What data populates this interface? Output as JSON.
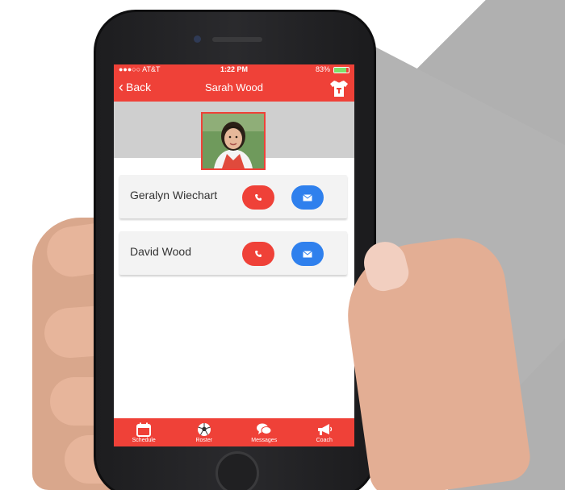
{
  "status_bar": {
    "carrier": "●●●○○ AT&T",
    "time": "1:22 PM",
    "battery": "83%"
  },
  "header": {
    "back_label": "Back",
    "title": "Sarah Wood"
  },
  "contacts": [
    {
      "name": "Geralyn Wiechart"
    },
    {
      "name": "David Wood"
    }
  ],
  "tabs": [
    {
      "label": "Schedule",
      "icon": "calendar-icon"
    },
    {
      "label": "Roster",
      "icon": "soccer-ball-icon"
    },
    {
      "label": "Messages",
      "icon": "chat-bubbles-icon"
    },
    {
      "label": "Coach",
      "icon": "megaphone-icon"
    }
  ],
  "colors": {
    "accent": "#ef4138",
    "message": "#2f80ed"
  }
}
